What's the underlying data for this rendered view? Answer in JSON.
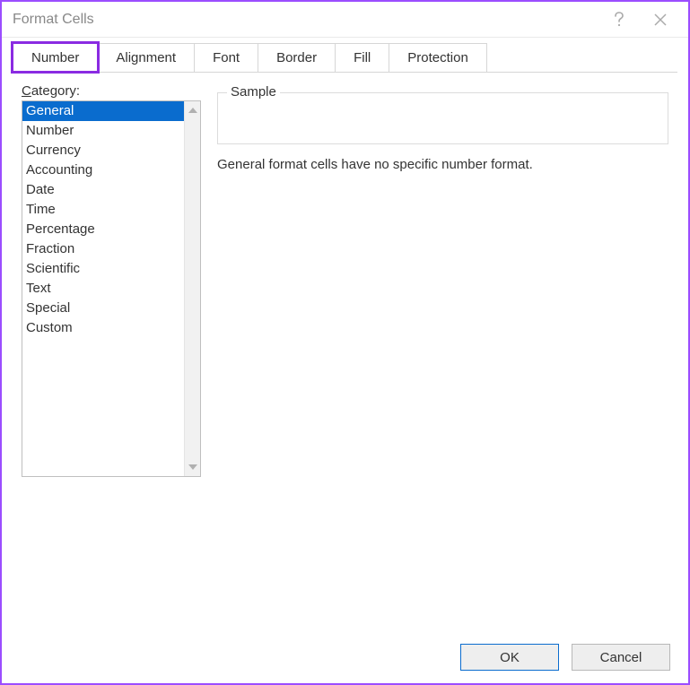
{
  "titlebar": {
    "title": "Format Cells"
  },
  "tabs": [
    {
      "label": "Number",
      "active": true,
      "highlighted": true
    },
    {
      "label": "Alignment",
      "active": false,
      "highlighted": false
    },
    {
      "label": "Font",
      "active": false,
      "highlighted": false
    },
    {
      "label": "Border",
      "active": false,
      "highlighted": false
    },
    {
      "label": "Fill",
      "active": false,
      "highlighted": false
    },
    {
      "label": "Protection",
      "active": false,
      "highlighted": false
    }
  ],
  "category": {
    "label_prefix": "C",
    "label_rest": "ategory:",
    "items": [
      "General",
      "Number",
      "Currency",
      "Accounting",
      "Date",
      "Time",
      "Percentage",
      "Fraction",
      "Scientific",
      "Text",
      "Special",
      "Custom"
    ],
    "selected_index": 0
  },
  "sample": {
    "legend": "Sample",
    "value": ""
  },
  "description": "General format cells have no specific number format.",
  "buttons": {
    "ok": "OK",
    "cancel": "Cancel"
  }
}
